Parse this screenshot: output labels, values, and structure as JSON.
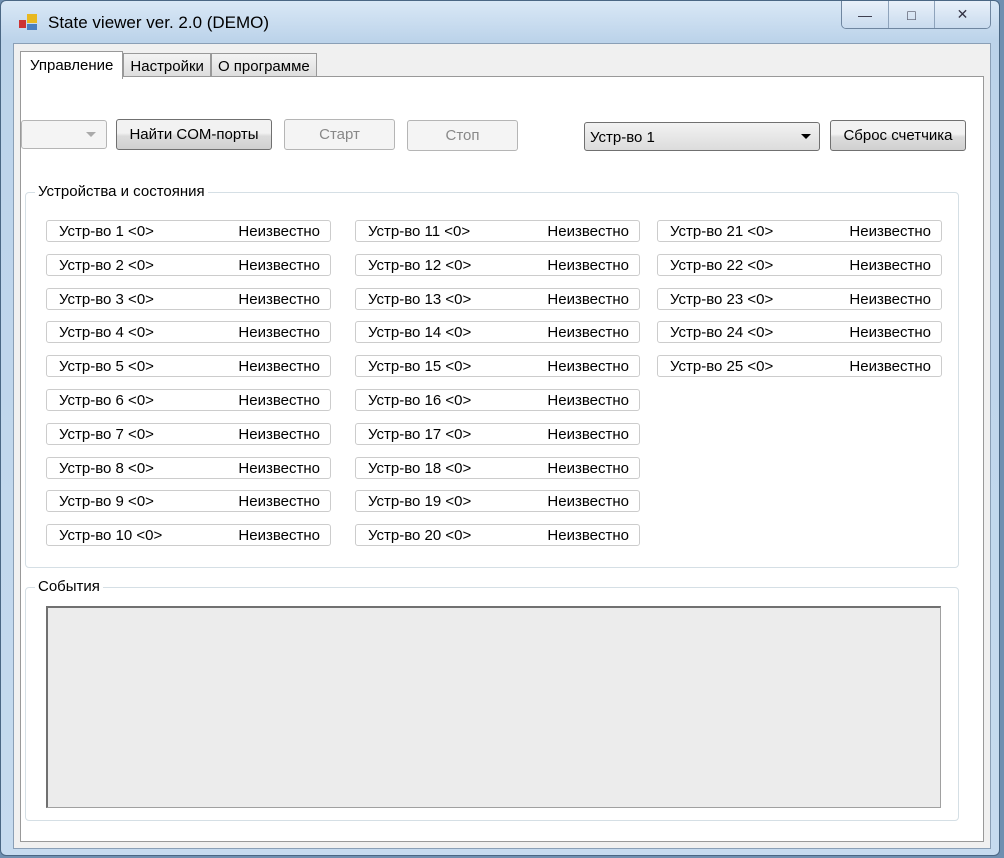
{
  "window": {
    "title": "State viewer ver. 2.0 (DEMO)",
    "minimize": "—",
    "maximize": "□",
    "close": "✕"
  },
  "tabs": [
    {
      "label": "Управление"
    },
    {
      "label": "Настройки"
    },
    {
      "label": "О программе"
    }
  ],
  "controls": {
    "port_combo_value": "",
    "find_ports": "Найти COM-порты",
    "start": "Старт",
    "stop": "Стоп",
    "device_select_value": "Устр-во 1",
    "reset_counter": "Сброс счетчика"
  },
  "devices_group": {
    "title": "Устройства и состояния",
    "devices": [
      {
        "name": "Устр-во 1 <0>",
        "state": "Неизвестно"
      },
      {
        "name": "Устр-во 2 <0>",
        "state": "Неизвестно"
      },
      {
        "name": "Устр-во 3 <0>",
        "state": "Неизвестно"
      },
      {
        "name": "Устр-во 4 <0>",
        "state": "Неизвестно"
      },
      {
        "name": "Устр-во 5 <0>",
        "state": "Неизвестно"
      },
      {
        "name": "Устр-во 6 <0>",
        "state": "Неизвестно"
      },
      {
        "name": "Устр-во 7 <0>",
        "state": "Неизвестно"
      },
      {
        "name": "Устр-во 8 <0>",
        "state": "Неизвестно"
      },
      {
        "name": "Устр-во 9 <0>",
        "state": "Неизвестно"
      },
      {
        "name": "Устр-во 10 <0>",
        "state": "Неизвестно"
      },
      {
        "name": "Устр-во 11 <0>",
        "state": "Неизвестно"
      },
      {
        "name": "Устр-во 12 <0>",
        "state": "Неизвестно"
      },
      {
        "name": "Устр-во 13 <0>",
        "state": "Неизвестно"
      },
      {
        "name": "Устр-во 14 <0>",
        "state": "Неизвестно"
      },
      {
        "name": "Устр-во 15 <0>",
        "state": "Неизвестно"
      },
      {
        "name": "Устр-во 16 <0>",
        "state": "Неизвестно"
      },
      {
        "name": "Устр-во 17 <0>",
        "state": "Неизвестно"
      },
      {
        "name": "Устр-во 18 <0>",
        "state": "Неизвестно"
      },
      {
        "name": "Устр-во 19 <0>",
        "state": "Неизвестно"
      },
      {
        "name": "Устр-во 20 <0>",
        "state": "Неизвестно"
      },
      {
        "name": "Устр-во 21 <0>",
        "state": "Неизвестно"
      },
      {
        "name": "Устр-во 22 <0>",
        "state": "Неизвестно"
      },
      {
        "name": "Устр-во 23 <0>",
        "state": "Неизвестно"
      },
      {
        "name": "Устр-во 24 <0>",
        "state": "Неизвестно"
      },
      {
        "name": "Устр-во 25 <0>",
        "state": "Неизвестно"
      }
    ]
  },
  "events_group": {
    "title": "События",
    "log": ""
  }
}
